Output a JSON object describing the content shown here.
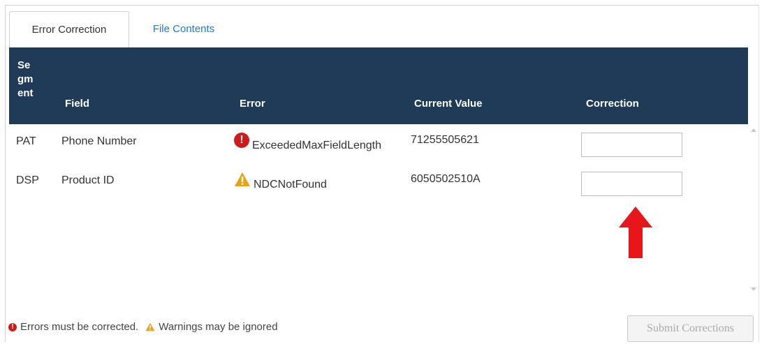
{
  "tabs": [
    {
      "label": "Error Correction",
      "active": true
    },
    {
      "label": "File Contents",
      "active": false
    }
  ],
  "table": {
    "headers": {
      "segment": "Se gm ent",
      "field": "Field",
      "error": "Error",
      "current_value": "Current Value",
      "correction": "Correction"
    },
    "rows": [
      {
        "segment": "PAT",
        "field": "Phone Number",
        "error_type": "error",
        "error_icon": "exclamation-circle-icon",
        "error": "ExceededMaxFieldLength",
        "current_value": "71255505621",
        "correction": ""
      },
      {
        "segment": "DSP",
        "field": "Product ID",
        "error_type": "warning",
        "error_icon": "warning-triangle-icon",
        "error": "NDCNotFound",
        "current_value": "6050502510A",
        "correction": ""
      }
    ]
  },
  "legend": {
    "errors_text": "Errors must be corrected.",
    "warnings_text": "Warnings may be ignored"
  },
  "submit_label": "Submit Corrections",
  "colors": {
    "header_bg": "#1f3b57",
    "error": "#d01919",
    "warning": "#e8a317",
    "link": "#1f7bd1",
    "arrow": "#e8161b"
  }
}
